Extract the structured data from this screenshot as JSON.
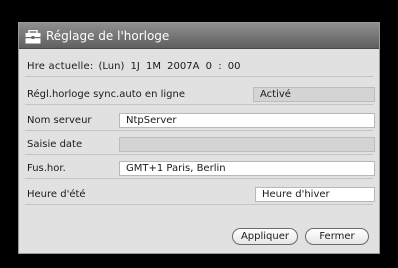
{
  "dialog": {
    "title": "Réglage de l'horloge",
    "current_time": {
      "label": "Hre actuelle:",
      "value": "(Lun) 1J 1M 2007A 0 : 00"
    },
    "sync": {
      "label": "Régl.horloge sync.auto en ligne",
      "value": "Activé"
    },
    "server": {
      "label": "Nom serveur",
      "value": "NtpServer"
    },
    "date_input": {
      "label": "Saisie date",
      "value": ""
    },
    "timezone": {
      "label": "Fus.hor.",
      "value": "GMT+1 Paris, Berlin"
    },
    "dst": {
      "label": "Heure d'été",
      "value": "Heure d'hiver"
    },
    "buttons": {
      "apply": "Appliquer",
      "close": "Fermer"
    }
  },
  "icons": {
    "title": "clock-settings-icon"
  }
}
